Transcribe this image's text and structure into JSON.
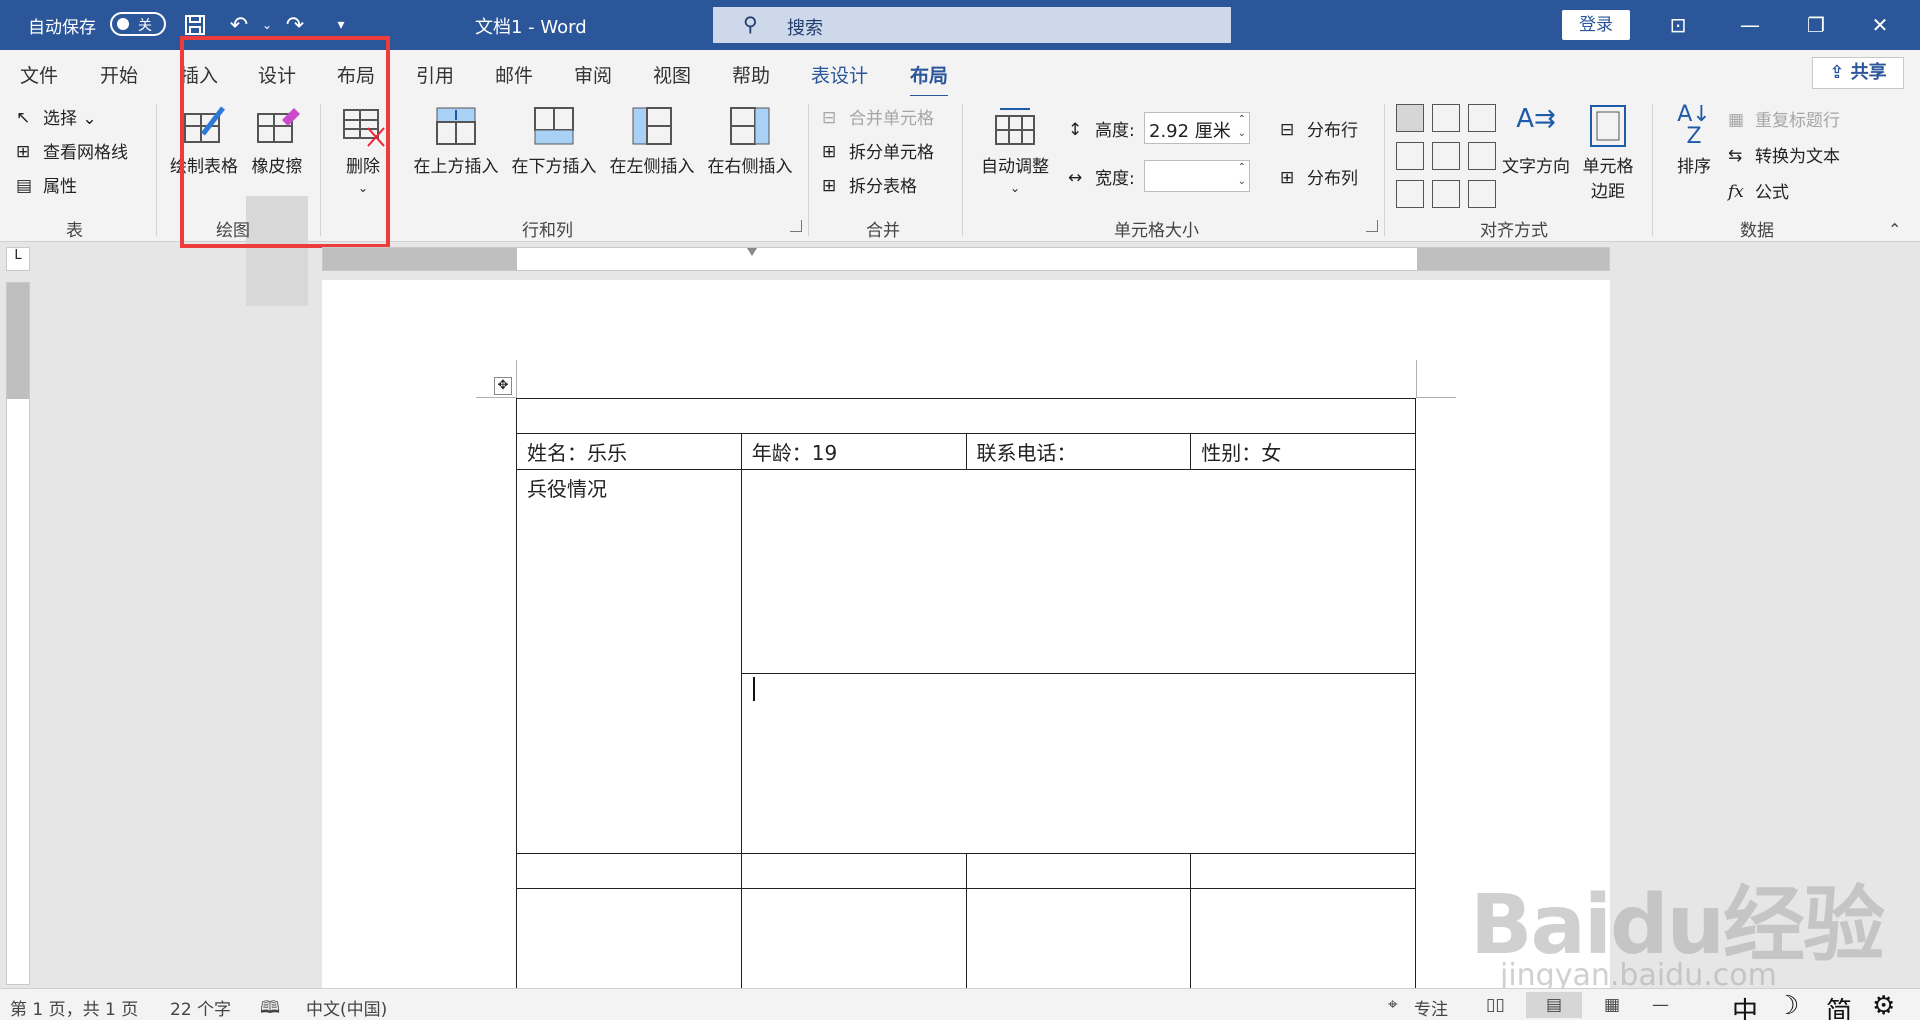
{
  "titlebar": {
    "autosave_label": "自动保存",
    "autosave_state": "关",
    "doc_title": "文档1 - Word",
    "search_placeholder": "搜索",
    "login_label": "登录"
  },
  "tabs": [
    "文件",
    "开始",
    "插入",
    "设计",
    "布局",
    "引用",
    "邮件",
    "审阅",
    "视图",
    "帮助",
    "表设计",
    "布局"
  ],
  "active_tab": "布局",
  "share_label": "共享",
  "ribbon": {
    "table_group": {
      "label": "表",
      "select": "选择",
      "gridlines": "查看网格线",
      "properties": "属性"
    },
    "draw_group": {
      "label": "绘图",
      "draw_table": "绘制表格",
      "eraser": "橡皮擦"
    },
    "delete_label": "删除",
    "rows_cols": {
      "label": "行和列",
      "above": "在上方插入",
      "below": "在下方插入",
      "left": "在左侧插入",
      "right": "在右侧插入"
    },
    "merge": {
      "label": "合并",
      "merge_cells": "合并单元格",
      "split_cells": "拆分单元格",
      "split_table": "拆分表格"
    },
    "cell_size": {
      "label": "单元格大小",
      "autofit": "自动调整",
      "height_label": "高度:",
      "height_value": "2.92 厘米",
      "width_label": "宽度:",
      "width_value": "",
      "dist_rows": "分布行",
      "dist_cols": "分布列"
    },
    "alignment": {
      "label": "对齐方式",
      "text_dir": "文字方向",
      "cell_margins_1": "单元格",
      "cell_margins_2": "边距"
    },
    "data": {
      "label": "数据",
      "sort": "排序",
      "repeat_header": "重复标题行",
      "to_text": "转换为文本",
      "formula": "公式"
    }
  },
  "document": {
    "name_cell": "姓名：乐乐",
    "age_cell": "年龄：19",
    "phone_cell": "联系电话：",
    "gender_cell": "性别：女",
    "military_cell": "兵役情况"
  },
  "status": {
    "page": "第 1 页，共 1 页",
    "words": "22 个字",
    "language": "中文(中国)",
    "focus": "专注",
    "ime": [
      "中",
      "简"
    ]
  },
  "watermark": {
    "brand": "Baidu经验",
    "url": "jingyan.baidu.com"
  }
}
